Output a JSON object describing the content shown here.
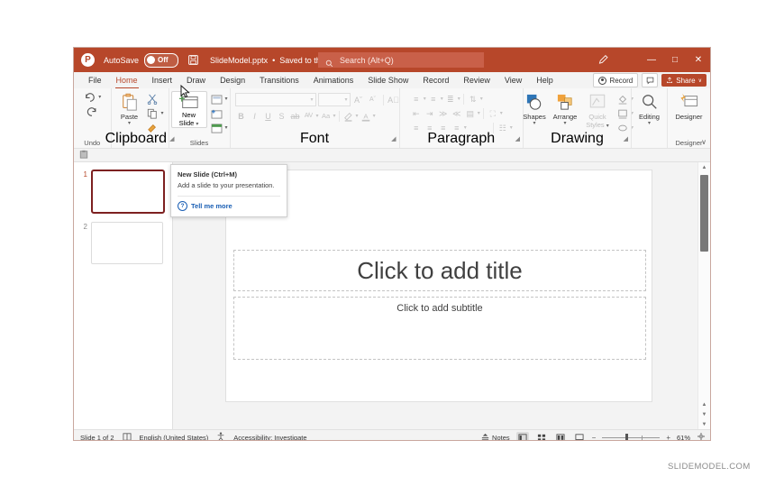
{
  "titlebar": {
    "logo": "pptx-logo-icon",
    "autosave_label": "AutoSave",
    "autosave_state": "Off",
    "save_icon": "save-icon",
    "filename": "SlideModel.pptx",
    "save_status": "Saved to this PC",
    "chevron": "∨",
    "search_placeholder": "Search (Alt+Q)",
    "pen_icon": "pen-icon",
    "minimize": "—",
    "maximize": "□",
    "close": "✕"
  },
  "tabs": [
    {
      "label": "File",
      "active": false
    },
    {
      "label": "Home",
      "active": true
    },
    {
      "label": "Insert",
      "active": false
    },
    {
      "label": "Draw",
      "active": false
    },
    {
      "label": "Design",
      "active": false
    },
    {
      "label": "Transitions",
      "active": false
    },
    {
      "label": "Animations",
      "active": false
    },
    {
      "label": "Slide Show",
      "active": false
    },
    {
      "label": "Record",
      "active": false
    },
    {
      "label": "Review",
      "active": false
    },
    {
      "label": "View",
      "active": false
    },
    {
      "label": "Help",
      "active": false
    }
  ],
  "tab_right": {
    "record_label": "Record",
    "comments_icon": "comment-icon",
    "share_label": "Share",
    "share_caret": "∨"
  },
  "ribbon": {
    "groups": [
      {
        "name": "Undo",
        "label": "Undo"
      },
      {
        "name": "Clipboard",
        "label": "Clipboard",
        "paste_label": "Paste"
      },
      {
        "name": "Slides",
        "label": "Slides",
        "new_slide_label_line1": "New",
        "new_slide_label_line2": "Slide"
      },
      {
        "name": "Font",
        "label": "Font"
      },
      {
        "name": "Paragraph",
        "label": "Paragraph"
      },
      {
        "name": "Drawing",
        "label": "Drawing",
        "shapes_label": "Shapes",
        "arrange_label": "Arrange",
        "quick_styles_line1": "Quick",
        "quick_styles_line2": "Styles"
      },
      {
        "name": "Editing",
        "label": "",
        "editing_label": "Editing"
      },
      {
        "name": "Designer",
        "label": "Designer",
        "designer_label": "Designer"
      }
    ],
    "collapse_caret": "∨"
  },
  "tooltip": {
    "title": "New Slide (Ctrl+M)",
    "description": "Add a slide to your presentation.",
    "link_label": "Tell me more",
    "help_icon": "question-icon"
  },
  "thumbnails": [
    {
      "number": "1",
      "selected": true
    },
    {
      "number": "2",
      "selected": false
    }
  ],
  "slide": {
    "title_placeholder": "Click to add title",
    "subtitle_placeholder": "Click to add subtitle"
  },
  "statusbar": {
    "slide_counter": "Slide 1 of 2",
    "slide_icon": "slide-icon",
    "language": "English (United States)",
    "accessibility_icon": "accessibility-icon",
    "accessibility": "Accessibility: Investigate",
    "notes_label": "Notes",
    "views": [
      {
        "name": "normal-view",
        "active": true
      },
      {
        "name": "slide-sorter-view",
        "active": false
      },
      {
        "name": "reading-view",
        "active": false
      },
      {
        "name": "slideshow-view",
        "active": false
      }
    ],
    "zoom_out": "−",
    "zoom_in": "+",
    "zoom_level": "61%",
    "fit_icon": "fit-to-window-icon"
  },
  "watermark": "SLIDEMODEL.COM",
  "colors": {
    "accent": "#b7472a",
    "selected_thumb_border": "#7d2020",
    "link": "#1a5fb4"
  }
}
